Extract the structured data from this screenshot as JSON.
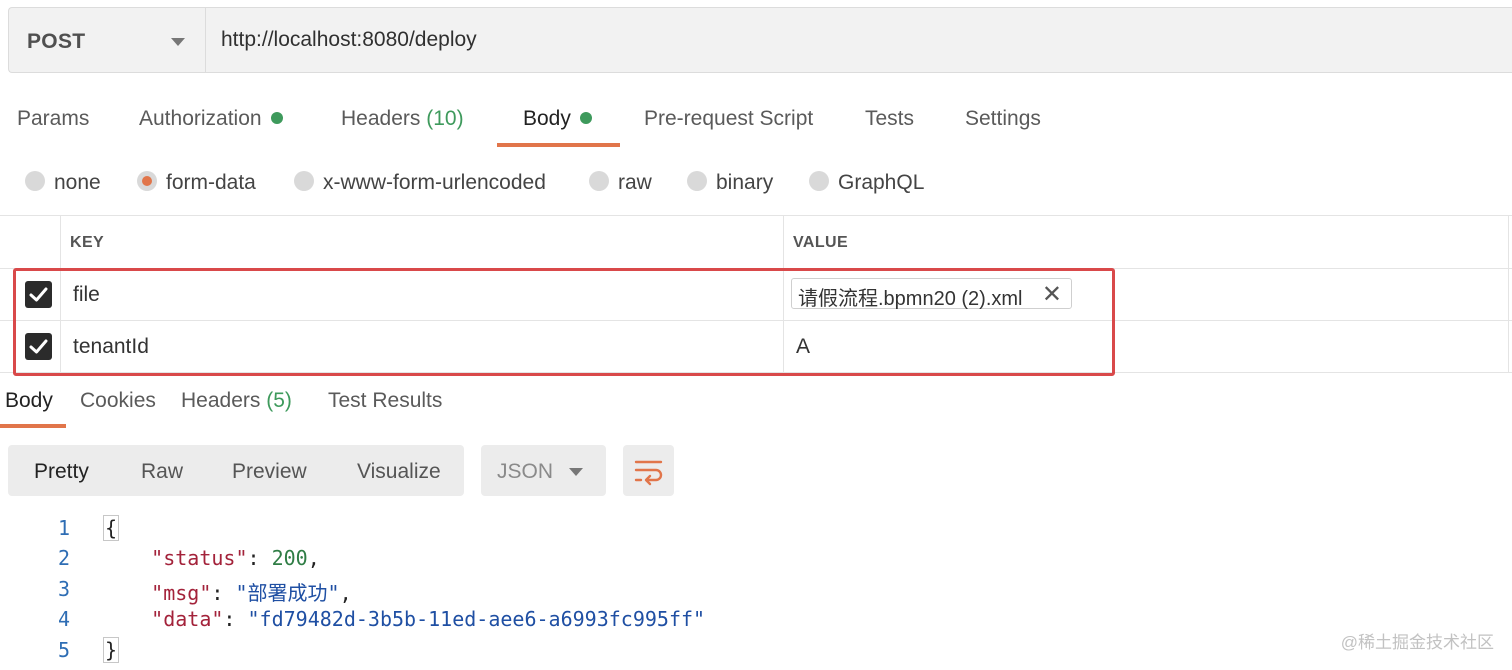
{
  "request": {
    "method": "POST",
    "url": "http://localhost:8080/deploy"
  },
  "request_tabs": [
    {
      "label": "Params",
      "count": "",
      "dot": false
    },
    {
      "label": "Authorization",
      "count": "",
      "dot": true
    },
    {
      "label": "Headers",
      "count": "(10)",
      "dot": false
    },
    {
      "label": "Body",
      "count": "",
      "dot": true,
      "active": true
    },
    {
      "label": "Pre-request Script",
      "count": "",
      "dot": false
    },
    {
      "label": "Tests",
      "count": "",
      "dot": false
    },
    {
      "label": "Settings",
      "count": "",
      "dot": false
    }
  ],
  "body_types": [
    {
      "label": "none",
      "selected": false
    },
    {
      "label": "form-data",
      "selected": true
    },
    {
      "label": "x-www-form-urlencoded",
      "selected": false
    },
    {
      "label": "raw",
      "selected": false
    },
    {
      "label": "binary",
      "selected": false
    },
    {
      "label": "GraphQL",
      "selected": false
    }
  ],
  "form_table": {
    "key_header": "KEY",
    "value_header": "VALUE",
    "rows": [
      {
        "checked": true,
        "key": "file",
        "value": "请假流程.bpmn20 (2).xml",
        "is_file": true
      },
      {
        "checked": true,
        "key": "tenantId",
        "value": "A",
        "is_file": false
      }
    ]
  },
  "response_tabs": [
    {
      "label": "Body",
      "count": "",
      "active": true
    },
    {
      "label": "Cookies",
      "count": ""
    },
    {
      "label": "Headers",
      "count": "(5)"
    },
    {
      "label": "Test Results",
      "count": ""
    }
  ],
  "view_modes": [
    "Pretty",
    "Raw",
    "Preview",
    "Visualize"
  ],
  "active_view_mode": "Pretty",
  "format": "JSON",
  "code": {
    "line_numbers": [
      "1",
      "2",
      "3",
      "4",
      "5"
    ],
    "open_brace": "{",
    "close_brace": "}",
    "status_key": "\"status\"",
    "status_value": "200",
    "msg_key": "\"msg\"",
    "msg_value": "\"部署成功\"",
    "data_key": "\"data\"",
    "data_value": "\"fd79482d-3b5b-11ed-aee6-a6993fc995ff\""
  },
  "colors": {
    "accent": "#e1754a",
    "status_dot": "#3e9a5c",
    "highlight_border": "#d9494a"
  },
  "watermark": "@稀土掘金技术社区"
}
